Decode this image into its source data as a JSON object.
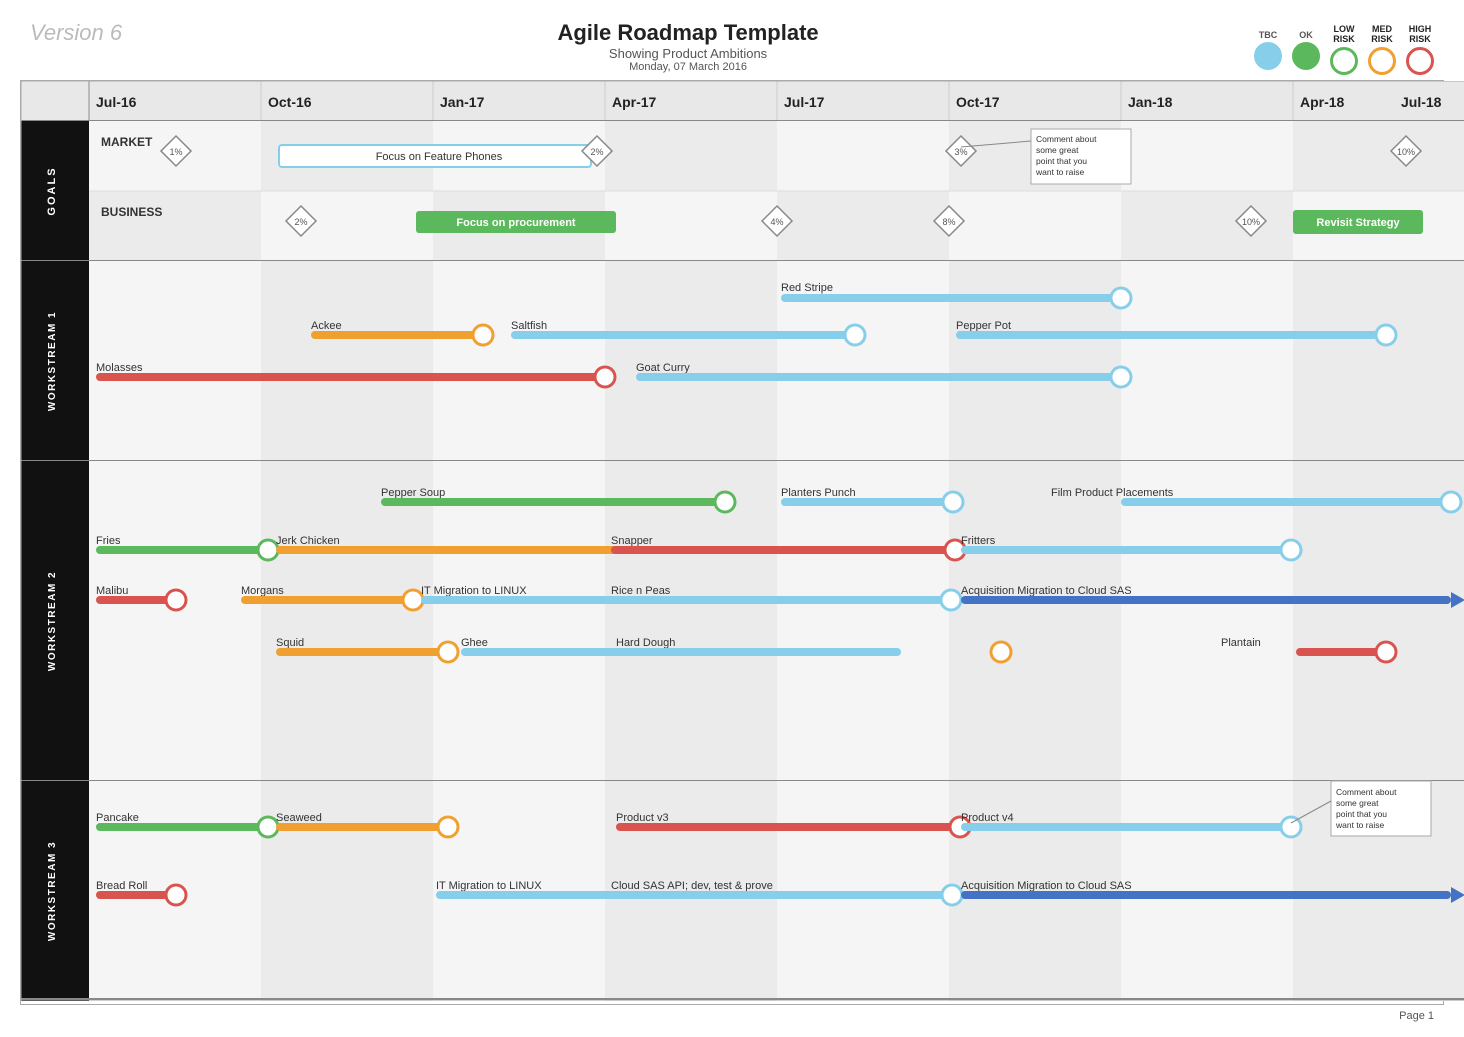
{
  "header": {
    "version": "Version 6",
    "title": "Agile Roadmap Template",
    "subtitle": "Showing Product Ambitions",
    "date": "Monday, 07 March 2016"
  },
  "legend": {
    "items": [
      {
        "label": "TBC",
        "color": "#87ceeb",
        "type": "tbc"
      },
      {
        "label": "OK",
        "color": "#5cb85c",
        "type": "ok"
      },
      {
        "label": "LOW\nRISK",
        "color": "#5cb85c",
        "type": "low"
      },
      {
        "label": "MED\nRISK",
        "color": "#f0a030",
        "type": "med"
      },
      {
        "label": "HIGH\nRISK",
        "color": "#d9534f",
        "type": "high"
      }
    ]
  },
  "timeline": {
    "labels": [
      "Jul-16",
      "Oct-16",
      "Jan-17",
      "Apr-17",
      "Jul-17",
      "Oct-17",
      "Jan-18",
      "Apr-18",
      "Jul-18"
    ]
  },
  "page_number": "Page 1"
}
